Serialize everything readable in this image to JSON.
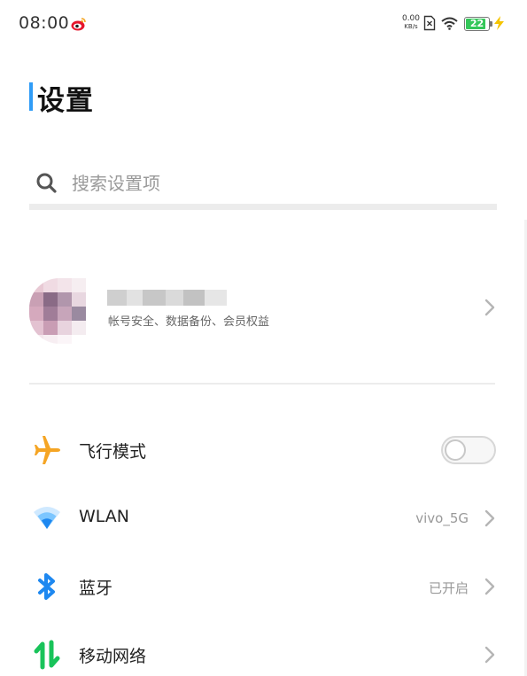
{
  "status_bar": {
    "time": "08:00",
    "net_speed_value": "0.00",
    "net_speed_unit": "KB/s",
    "battery_level": "22",
    "icons": [
      "weibo-icon",
      "no-sim-icon",
      "wifi-icon",
      "battery-icon",
      "charging-bolt-icon"
    ],
    "battery_color": "#34c759"
  },
  "page": {
    "title": "设置",
    "accent_color": "#2f9cf7"
  },
  "search": {
    "value": "",
    "placeholder": "搜索设置项"
  },
  "account": {
    "name": "",
    "subtitle": "帐号安全、数据备份、会员权益",
    "avatar": "pixelated-avatar"
  },
  "settings": [
    {
      "icon": "airplane-icon",
      "label": "飞行模式",
      "value": "",
      "control": "toggle",
      "toggle_on": false
    },
    {
      "icon": "wifi-icon",
      "label": "WLAN",
      "value": "vivo_5G",
      "control": "chevron"
    },
    {
      "icon": "bluetooth-icon",
      "label": "蓝牙",
      "value": "已开启",
      "control": "chevron"
    },
    {
      "icon": "mobile-network-icon",
      "label": "移动网络",
      "value": "",
      "control": "chevron"
    }
  ]
}
